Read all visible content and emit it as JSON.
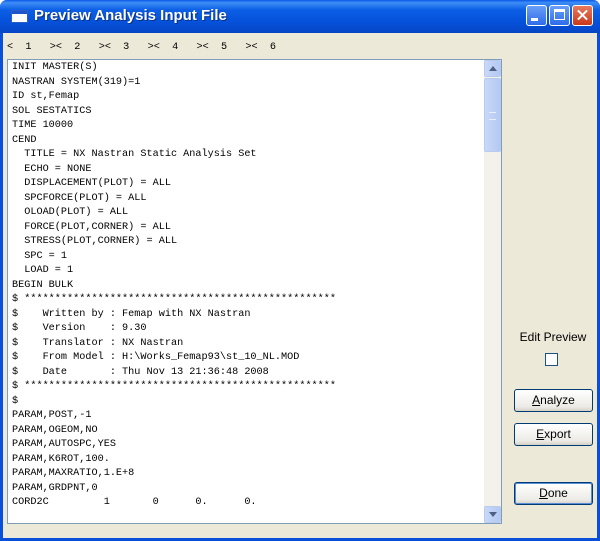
{
  "window": {
    "title": "Preview Analysis Input File"
  },
  "ruler": "<  1   ><  2   ><  3   ><  4   ><  5   ><  6",
  "lines": [
    "INIT MASTER(S)",
    "NASTRAN SYSTEM(319)=1",
    "ID st,Femap",
    "SOL SESTATICS",
    "TIME 10000",
    "CEND",
    "  TITLE = NX Nastran Static Analysis Set",
    "  ECHO = NONE",
    "  DISPLACEMENT(PLOT) = ALL",
    "  SPCFORCE(PLOT) = ALL",
    "  OLOAD(PLOT) = ALL",
    "  FORCE(PLOT,CORNER) = ALL",
    "  STRESS(PLOT,CORNER) = ALL",
    "  SPC = 1",
    "  LOAD = 1",
    "BEGIN BULK",
    "$ ***************************************************",
    "$    Written by : Femap with NX Nastran",
    "$    Version    : 9.30",
    "$    Translator : NX Nastran",
    "$    From Model : H:\\Works_Femap93\\st_10_NL.MOD",
    "$    Date       : Thu Nov 13 21:36:48 2008",
    "$ ***************************************************",
    "$",
    "PARAM,POST,-1",
    "PARAM,OGEOM,NO",
    "PARAM,AUTOSPC,YES",
    "PARAM,K6ROT,100.",
    "PARAM,MAXRATIO,1.E+8",
    "PARAM,GRDPNT,0",
    "CORD2C         1       0      0.      0."
  ],
  "side": {
    "edit_preview_label": "Edit Preview",
    "analyze": {
      "accel": "A",
      "rest": "nalyze"
    },
    "export": {
      "accel": "E",
      "rest": "xport"
    },
    "done": {
      "accel": "D",
      "rest": "one"
    }
  }
}
